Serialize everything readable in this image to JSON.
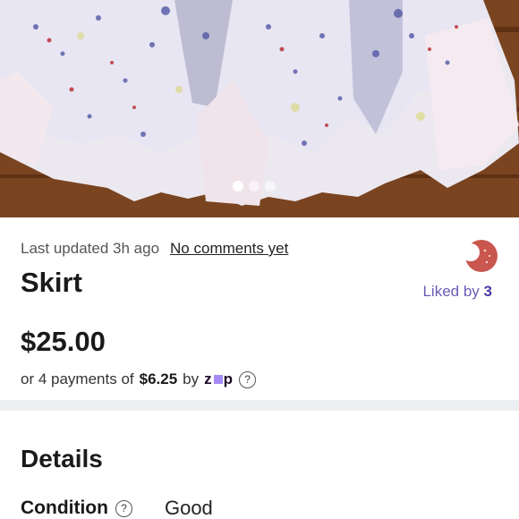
{
  "listing": {
    "last_updated": "Last updated 3h ago",
    "comments_link": "No comments yet",
    "title": "Skirt",
    "liked_prefix": "Liked by",
    "liked_count": "3",
    "price": "$25.00",
    "installments_prefix": "or 4 payments of",
    "installment_amount": "$6.25",
    "installments_by": "by",
    "installment_brand": "zip",
    "photo_count": 3,
    "photo_active_index": 0
  },
  "details": {
    "heading": "Details",
    "condition_label": "Condition",
    "condition_value": "Good"
  },
  "icons": {
    "help": "question-circle-icon",
    "avatar": "seller-avatar"
  },
  "colors": {
    "accent_purple": "#6d5bb7",
    "divider": "#eceff2",
    "avatar": "#c9574f"
  }
}
